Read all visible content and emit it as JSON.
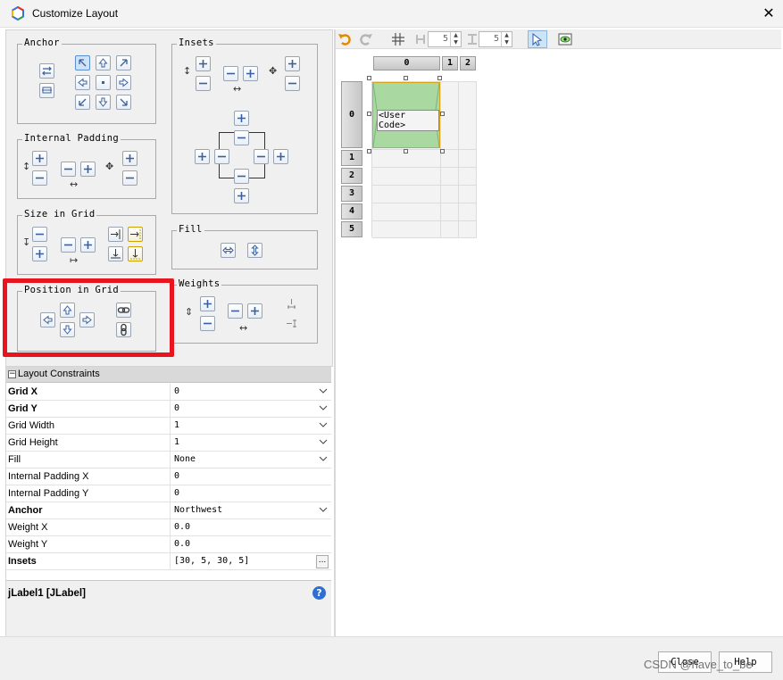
{
  "window": {
    "title": "Customize Layout",
    "close_glyph": "✕"
  },
  "groups": {
    "anchor": "Anchor",
    "insets": "Insets",
    "internal_padding": "Internal Padding",
    "size_in_grid": "Size in Grid",
    "fill": "Fill",
    "position_in_grid": "Position in Grid",
    "weights": "Weights"
  },
  "property_sheet": {
    "header": "Layout Constraints",
    "toggle": "−",
    "rows": [
      {
        "name": "Grid X",
        "value": "0"
      },
      {
        "name": "Grid Y",
        "value": "0"
      },
      {
        "name": "Grid Width",
        "value": "1"
      },
      {
        "name": "Grid Height",
        "value": "1"
      },
      {
        "name": "Fill",
        "value": "None"
      },
      {
        "name": "Internal Padding X",
        "value": "0"
      },
      {
        "name": "Internal Padding Y",
        "value": "0"
      },
      {
        "name": "Anchor",
        "value": "Northwest"
      },
      {
        "name": "Weight X",
        "value": "0.0"
      },
      {
        "name": "Weight Y",
        "value": "0.0"
      },
      {
        "name": "Insets",
        "value": "[30, 5, 30, 5]"
      }
    ],
    "ellipsis": "...",
    "selected_component": "jLabel1 [JLabel]",
    "help_glyph": "?"
  },
  "designer": {
    "h_gap": "5",
    "v_gap": "5",
    "column_headers": [
      "0",
      "1",
      "2"
    ],
    "row_headers": [
      "0",
      "1",
      "2",
      "3",
      "4",
      "5"
    ],
    "component_label": "<User Code>"
  },
  "footer": {
    "close_label": "Close",
    "help_label": "Help",
    "watermark": "CSDN @have_to_be"
  },
  "colors": {
    "highlight": "#e8141e",
    "component_fill": "#a9d8a0",
    "component_border": "#d6a41a"
  },
  "icons": [
    "logo-icon",
    "close-icon",
    "undo-icon",
    "redo-icon",
    "grid-gap-icon",
    "select-mode-icon",
    "preview-icon",
    "plus-icon",
    "minus-icon",
    "arrow-icon",
    "link-icon",
    "help-icon"
  ]
}
